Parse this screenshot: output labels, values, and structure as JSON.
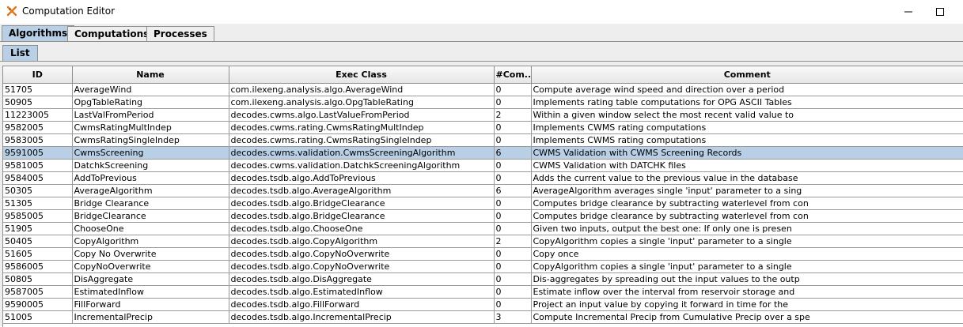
{
  "window": {
    "title": "Computation Editor"
  },
  "tabs": [
    {
      "label": "Algorithms",
      "active": true
    },
    {
      "label": "Computations",
      "active": false
    },
    {
      "label": "Processes",
      "active": false
    }
  ],
  "subtab": {
    "label": "List"
  },
  "colors": {
    "accent": "#b8cfe5",
    "selection": "#b8cfe5",
    "header_bg": "#eeeeee"
  },
  "table": {
    "columns": [
      "ID",
      "Name",
      "Exec Class",
      "#Com...",
      "Comment"
    ],
    "selected_row": 5,
    "rows": [
      [
        "51705",
        "AverageWind",
        "com.ilexeng.analysis.algo.AverageWind",
        "0",
        "Compute average wind speed and direction over a period"
      ],
      [
        "50905",
        "OpgTableRating",
        "com.ilexeng.analysis.algo.OpgTableRating",
        "0",
        "Implements rating table computations for OPG ASCII Tables"
      ],
      [
        "11223005",
        "LastValFromPeriod",
        "decodes.cwms.algo.LastValueFromPeriod",
        "2",
        "Within a given window select the most recent valid value to"
      ],
      [
        "9582005",
        "CwmsRatingMultIndep",
        "decodes.cwms.rating.CwmsRatingMultIndep",
        "0",
        "Implements CWMS rating computations"
      ],
      [
        "9583005",
        "CwmsRatingSingleIndep",
        "decodes.cwms.rating.CwmsRatingSingleIndep",
        "0",
        "Implements CWMS rating computations"
      ],
      [
        "9591005",
        "CwmsScreening",
        "decodes.cwms.validation.CwmsScreeningAlgorithm",
        "6",
        "CWMS Validation with CWMS Screening Records"
      ],
      [
        "9581005",
        "DatchkScreening",
        "decodes.cwms.validation.DatchkScreeningAlgorithm",
        "0",
        "CWMS Validation with DATCHK files"
      ],
      [
        "9584005",
        "AddToPrevious",
        "decodes.tsdb.algo.AddToPrevious",
        "0",
        "Adds the current value to the previous value in the database"
      ],
      [
        "50305",
        "AverageAlgorithm",
        "decodes.tsdb.algo.AverageAlgorithm",
        "6",
        "AverageAlgorithm averages single 'input' parameter to a sing"
      ],
      [
        "51305",
        "Bridge Clearance",
        "decodes.tsdb.algo.BridgeClearance",
        "0",
        "Computes bridge clearance by subtracting waterlevel from con"
      ],
      [
        "9585005",
        "BridgeClearance",
        "decodes.tsdb.algo.BridgeClearance",
        "0",
        "Computes bridge clearance by subtracting waterlevel from con"
      ],
      [
        "51905",
        "ChooseOne",
        "decodes.tsdb.algo.ChooseOne",
        "0",
        "Given two inputs, output the best one: If only one is presen"
      ],
      [
        "50405",
        "CopyAlgorithm",
        "decodes.tsdb.algo.CopyAlgorithm",
        "2",
        "CopyAlgorithm copies a single 'input' parameter to a single"
      ],
      [
        "51605",
        "Copy No Overwrite",
        "decodes.tsdb.algo.CopyNoOverwrite",
        "0",
        "Copy once"
      ],
      [
        "9586005",
        "CopyNoOverwrite",
        "decodes.tsdb.algo.CopyNoOverwrite",
        "0",
        "CopyAlgorithm copies a single 'input' parameter to a single"
      ],
      [
        "50805",
        "DisAggregate",
        "decodes.tsdb.algo.DisAggregate",
        "0",
        "Dis-aggregates by spreading out the input values to the outp"
      ],
      [
        "9587005",
        "EstimatedInflow",
        "decodes.tsdb.algo.EstimatedInflow",
        "0",
        "Estimate inflow over the interval from reservoir storage and"
      ],
      [
        "9590005",
        "FillForward",
        "decodes.tsdb.algo.FillForward",
        "0",
        "Project an input value by copying it forward in time for the"
      ],
      [
        "51005",
        "IncrementalPrecip",
        "decodes.tsdb.algo.IncrementalPrecip",
        "3",
        "Compute Incremental Precip from Cumulative Precip over a spe"
      ]
    ]
  }
}
